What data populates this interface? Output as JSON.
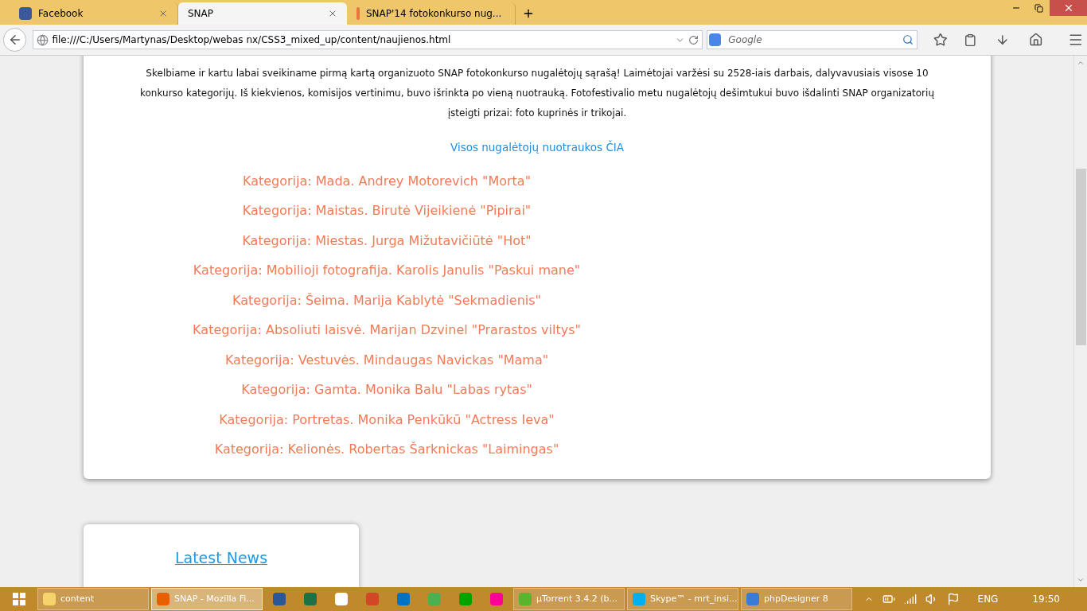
{
  "tabs": [
    {
      "label": "Facebook",
      "selected": false
    },
    {
      "label": "SNAP",
      "selected": true
    },
    {
      "label": "SNAP'14 fotokonkurso nug...",
      "selected": false
    }
  ],
  "address": "file:///C:/Users/Martynas/Desktop/webas nx/CSS3_mixed_up/content/naujienos.html",
  "search": {
    "placeholder": "Google"
  },
  "article": {
    "paragraph": "Skelbiame ir kartu labai sveikiname pirmą kartą organizuoto SNAP fotokonkurso nugalėtojų sąrašą! Laimėtojai varžėsi su 2528-iais darbais, dalyvavusiais visose 10 konkurso kategorijų. Iš kiekvienos, komisijos vertinimu, buvo išrinkta po vieną nuotrauką. Fotofestivalio metu nugalėtojų dešimtukui buvo išdalinti SNAP organizatorių įsteigti prizai: foto kuprinės ir trikojai.",
    "link": "Visos nugalėtojų nuotraukos ČIA",
    "winners": [
      "Kategorija: Mada. Andrey Motorevich \"Morta\"",
      "Kategorija: Maistas. Birutė Vijeikienė \"Pipirai\"",
      "Kategorija: Miestas. Jurga Mižutavičiūtė \"Hot\"",
      "Kategorija: Mobilioji fotografija. Karolis Janulis \"Paskui mane\"",
      "Kategorija: Šeima. Marija Kablytė \"Sekmadienis\"",
      "Kategorija: Absoliuti laisvė. Marijan Dzvinel \"Prarastos viltys\"",
      "Kategorija: Vestuvės. Mindaugas Navickas \"Mama\"",
      "Kategorija: Gamta. Monika Balu \"Labas rytas\"",
      "Kategorija: Portretas. Monika Penkūkū \"Actress Ieva\"",
      "Kategorija: Kelionės. Robertas Šarknickas \"Laimingas\""
    ]
  },
  "news": {
    "title": "Latest News"
  },
  "taskbar": {
    "items": [
      {
        "kind": "window",
        "label": "content",
        "selected": false
      },
      {
        "kind": "window",
        "label": "SNAP - Mozilla Fi...",
        "selected": true
      },
      {
        "kind": "pin"
      },
      {
        "kind": "pin"
      },
      {
        "kind": "pin"
      },
      {
        "kind": "pin"
      },
      {
        "kind": "pin"
      },
      {
        "kind": "pin"
      },
      {
        "kind": "pin"
      },
      {
        "kind": "pin"
      },
      {
        "kind": "window",
        "label": "µTorrent 3.4.2  (b...",
        "selected": false
      },
      {
        "kind": "window",
        "label": "Skype™ - mrt_insi...",
        "selected": false
      },
      {
        "kind": "window",
        "label": "phpDesigner 8",
        "selected": false
      }
    ],
    "language": "ENG",
    "time": "19:50"
  }
}
